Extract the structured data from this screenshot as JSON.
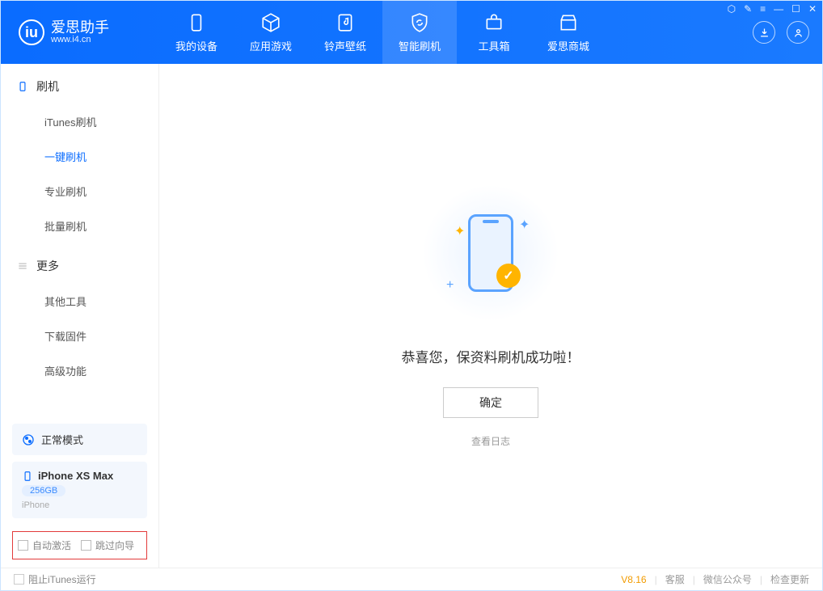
{
  "app": {
    "title": "爱思助手",
    "subtitle": "www.i4.cn"
  },
  "tabs": {
    "device": "我的设备",
    "apps": "应用游戏",
    "ring": "铃声壁纸",
    "flash": "智能刷机",
    "tools": "工具箱",
    "store": "爱思商城"
  },
  "sidebar": {
    "section1": "刷机",
    "items1": [
      "iTunes刷机",
      "一键刷机",
      "专业刷机",
      "批量刷机"
    ],
    "section2": "更多",
    "items2": [
      "其他工具",
      "下载固件",
      "高级功能"
    ]
  },
  "mode": {
    "label": "正常模式"
  },
  "device": {
    "name": "iPhone XS Max",
    "capacity": "256GB",
    "type": "iPhone"
  },
  "opts": {
    "auto_activate": "自动激活",
    "skip_guide": "跳过向导"
  },
  "main": {
    "success_msg": "恭喜您，保资料刷机成功啦！",
    "ok": "确定",
    "log": "查看日志"
  },
  "footer": {
    "block_itunes": "阻止iTunes运行",
    "version": "V8.16",
    "support": "客服",
    "wechat": "微信公众号",
    "update": "检查更新"
  }
}
